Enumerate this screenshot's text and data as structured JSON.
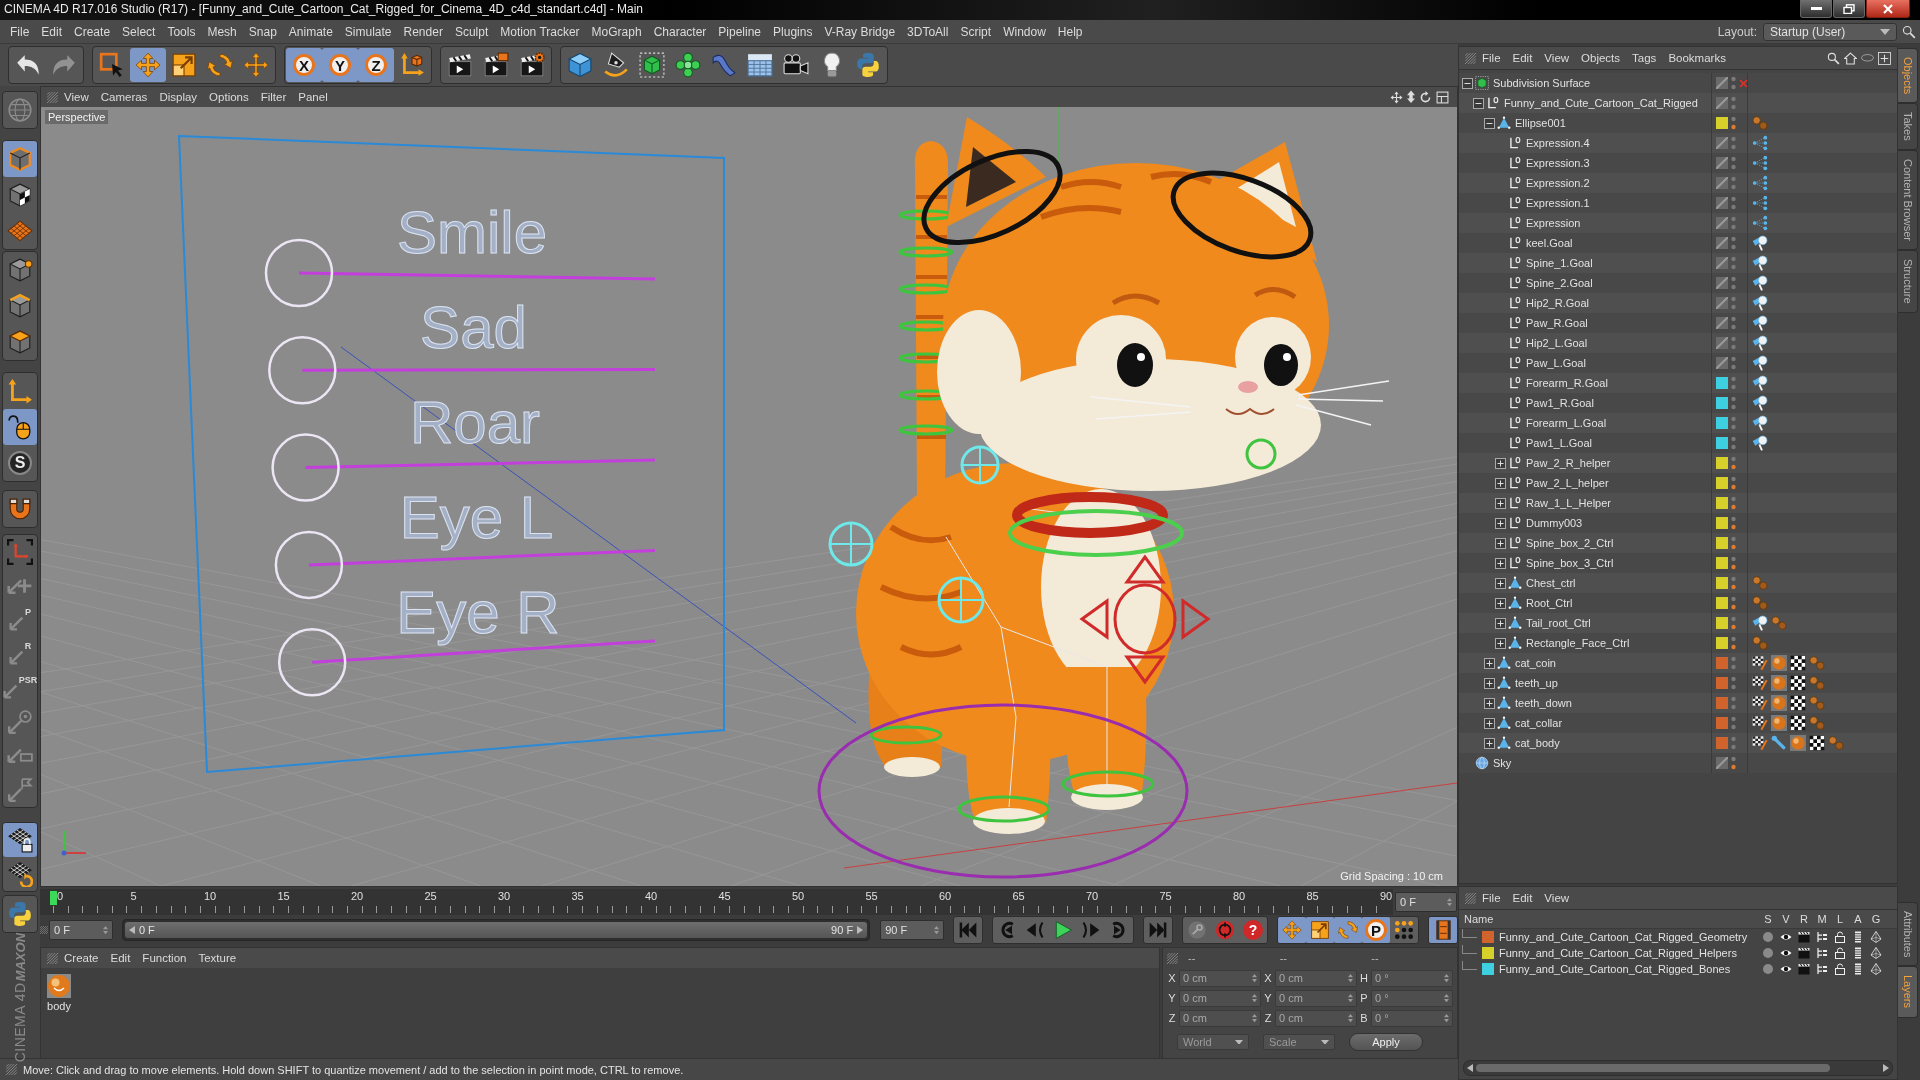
{
  "window": {
    "title": "CINEMA 4D R17.016 Studio (R17) - [Funny_and_Cute_Cartoon_Cat_Rigged_for_Cinema_4D_c4d_standart.c4d] - Main"
  },
  "menu_bar": {
    "items": [
      "File",
      "Edit",
      "Create",
      "Select",
      "Tools",
      "Mesh",
      "Snap",
      "Animate",
      "Simulate",
      "Render",
      "Sculpt",
      "Motion Tracker",
      "MoGraph",
      "Character",
      "Pipeline",
      "Plugins",
      "V-Ray Bridge",
      "3DToAll",
      "Script",
      "Window",
      "Help"
    ],
    "layout_label": "Layout:",
    "layout_value": "Startup (User)"
  },
  "toolbar": {
    "groups": [
      [
        {
          "kind": "undo",
          "disabled": false
        },
        {
          "kind": "redo",
          "disabled": true
        }
      ],
      [
        {
          "kind": "select",
          "selected": false
        },
        {
          "kind": "move",
          "selected": true
        },
        {
          "kind": "scale",
          "selected": false
        },
        {
          "kind": "rotate",
          "selected": false
        },
        {
          "kind": "last",
          "selected": false
        }
      ],
      [
        {
          "kind": "axis_lock",
          "label": "X",
          "selected": true
        },
        {
          "kind": "axis_lock",
          "label": "Y",
          "selected": true
        },
        {
          "kind": "axis_lock",
          "label": "Z",
          "selected": true
        },
        {
          "kind": "coords",
          "selected": false
        }
      ],
      [
        {
          "kind": "render_view"
        },
        {
          "kind": "render_picture"
        },
        {
          "kind": "render_settings"
        }
      ],
      [
        {
          "kind": "cube"
        },
        {
          "kind": "pen"
        },
        {
          "kind": "subdivision"
        },
        {
          "kind": "cloner"
        },
        {
          "kind": "deformer"
        },
        {
          "kind": "floor"
        },
        {
          "kind": "camera"
        },
        {
          "kind": "light"
        },
        {
          "kind": "python"
        }
      ]
    ]
  },
  "left_palette": {
    "groups": [
      [
        {
          "kind": "globe",
          "disabled": true
        }
      ],
      [
        {
          "kind": "model",
          "selected": true
        },
        {
          "kind": "texture",
          "selected": false
        },
        {
          "kind": "workplane",
          "selected": false
        }
      ],
      [
        {
          "kind": "points",
          "selected": false
        },
        {
          "kind": "edges",
          "selected": false
        },
        {
          "kind": "polygons",
          "selected": false
        }
      ],
      [
        {
          "kind": "axis",
          "selected": false
        },
        {
          "kind": "tweak",
          "selected": true
        },
        {
          "kind": "snap",
          "label": "S",
          "selected": false
        }
      ],
      [
        {
          "kind": "magnet",
          "selected": false
        }
      ],
      [
        {
          "kind": "axis_corners",
          "disabled": false
        },
        {
          "kind": "quantize",
          "disabled": true
        },
        {
          "kind": "lock",
          "label": "P",
          "disabled": true
        },
        {
          "kind": "lock",
          "label": "R",
          "disabled": true
        },
        {
          "kind": "lock",
          "label": "PSR",
          "disabled": true
        },
        {
          "kind": "circle_lock",
          "disabled": true
        },
        {
          "kind": "rect_lock",
          "disabled": true
        },
        {
          "kind": "flag_lock",
          "disabled": true
        }
      ],
      [
        {
          "kind": "grid_lock",
          "selected": true
        },
        {
          "kind": "grid_cycle",
          "selected": false
        }
      ],
      [
        {
          "kind": "python"
        }
      ]
    ]
  },
  "viewport": {
    "menu": [
      "View",
      "Cameras",
      "Display",
      "Options",
      "Filter",
      "Panel"
    ],
    "camera": "Perspective",
    "grid_spacing": "Grid Spacing : 10 cm",
    "face_sliders": [
      {
        "label": "Smile",
        "level": 0
      },
      {
        "label": "Sad",
        "level": 0
      },
      {
        "label": "Roar",
        "level": 0
      },
      {
        "label": "Eye L",
        "level": 0
      },
      {
        "label": "Eye R",
        "level": 0
      }
    ]
  },
  "object_manager": {
    "menu": [
      "File",
      "Edit",
      "View",
      "Objects",
      "Tags",
      "Bookmarks"
    ],
    "objects": [
      {
        "name": "Subdivision Surface",
        "kind": "subdivision",
        "expanded": true,
        "generator_enabled": false,
        "render_dot_lit": false,
        "children": [
          {
            "name": "Funny_and_Cute_Cartoon_Cat_Rigged",
            "kind": "null",
            "expanded": true,
            "render_dot_lit": false,
            "children": [
              {
                "name": "Ellipse001",
                "kind": "polygon",
                "expanded": true,
                "color": "#d8d02a",
                "render_dot_lit": true,
                "tags": [
                  {
                    "kind": "dots"
                  }
                ],
                "children": [
                  {
                    "name": "Expression.4",
                    "kind": "null",
                    "render_dot_lit": false,
                    "tags": [
                      {
                        "kind": "xpresso"
                      }
                    ]
                  },
                  {
                    "name": "Expression.3",
                    "kind": "null",
                    "render_dot_lit": false,
                    "tags": [
                      {
                        "kind": "xpresso"
                      }
                    ]
                  },
                  {
                    "name": "Expression.2",
                    "kind": "null",
                    "render_dot_lit": false,
                    "tags": [
                      {
                        "kind": "xpresso"
                      }
                    ]
                  },
                  {
                    "name": "Expression.1",
                    "kind": "null",
                    "render_dot_lit": false,
                    "tags": [
                      {
                        "kind": "xpresso"
                      }
                    ]
                  },
                  {
                    "name": "Expression",
                    "kind": "null",
                    "render_dot_lit": false,
                    "tags": [
                      {
                        "kind": "xpresso"
                      }
                    ]
                  },
                  {
                    "name": "keel.Goal",
                    "kind": "null",
                    "render_dot_lit": false,
                    "tags": [
                      {
                        "kind": "ik"
                      }
                    ]
                  },
                  {
                    "name": "Spine_1.Goal",
                    "kind": "null",
                    "render_dot_lit": false,
                    "tags": [
                      {
                        "kind": "ik"
                      }
                    ]
                  },
                  {
                    "name": "Spine_2.Goal",
                    "kind": "null",
                    "render_dot_lit": false,
                    "tags": [
                      {
                        "kind": "ik"
                      }
                    ]
                  },
                  {
                    "name": "Hip2_R.Goal",
                    "kind": "null",
                    "render_dot_lit": false,
                    "tags": [
                      {
                        "kind": "ik"
                      }
                    ]
                  },
                  {
                    "name": "Paw_R.Goal",
                    "kind": "null",
                    "render_dot_lit": false,
                    "tags": [
                      {
                        "kind": "ik"
                      }
                    ]
                  },
                  {
                    "name": "Hip2_L.Goal",
                    "kind": "null",
                    "render_dot_lit": false,
                    "tags": [
                      {
                        "kind": "ik"
                      }
                    ]
                  },
                  {
                    "name": "Paw_L.Goal",
                    "kind": "null",
                    "render_dot_lit": false,
                    "tags": [
                      {
                        "kind": "ik"
                      }
                    ]
                  },
                  {
                    "name": "Forearm_R.Goal",
                    "kind": "null",
                    "color": "#3ed0e0",
                    "render_dot_lit": false,
                    "tags": [
                      {
                        "kind": "ik"
                      }
                    ]
                  },
                  {
                    "name": "Paw1_R.Goal",
                    "kind": "null",
                    "color": "#3ed0e0",
                    "render_dot_lit": false,
                    "tags": [
                      {
                        "kind": "ik"
                      }
                    ]
                  },
                  {
                    "name": "Forearm_L.Goal",
                    "kind": "null",
                    "color": "#3ed0e0",
                    "render_dot_lit": false,
                    "tags": [
                      {
                        "kind": "ik"
                      }
                    ]
                  },
                  {
                    "name": "Paw1_L.Goal",
                    "kind": "null",
                    "color": "#3ed0e0",
                    "render_dot_lit": false,
                    "tags": [
                      {
                        "kind": "ik"
                      }
                    ]
                  },
                  {
                    "name": "Paw_2_R_helper",
                    "kind": "null",
                    "expanded": false,
                    "color": "#d8d02a",
                    "render_dot_lit": true
                  },
                  {
                    "name": "Paw_2_L_helper",
                    "kind": "null",
                    "expanded": false,
                    "color": "#d8d02a",
                    "render_dot_lit": true
                  },
                  {
                    "name": "Raw_1_L_Helper",
                    "kind": "null",
                    "expanded": false,
                    "color": "#d8d02a",
                    "render_dot_lit": true
                  },
                  {
                    "name": "Dummy003",
                    "kind": "null",
                    "expanded": false,
                    "color": "#d8d02a",
                    "render_dot_lit": true
                  },
                  {
                    "name": "Spine_box_2_Ctrl",
                    "kind": "null",
                    "expanded": false,
                    "color": "#d8d02a",
                    "render_dot_lit": true
                  },
                  {
                    "name": "Spine_box_3_Ctrl",
                    "kind": "null",
                    "expanded": false,
                    "color": "#d8d02a",
                    "render_dot_lit": true
                  },
                  {
                    "name": "Chest_ctrl",
                    "kind": "polygon",
                    "expanded": false,
                    "color": "#d8d02a",
                    "render_dot_lit": true,
                    "tags": [
                      {
                        "kind": "dots"
                      }
                    ]
                  },
                  {
                    "name": "Root_Ctrl",
                    "kind": "polygon",
                    "expanded": false,
                    "color": "#d8d02a",
                    "render_dot_lit": true,
                    "tags": [
                      {
                        "kind": "dots"
                      }
                    ]
                  },
                  {
                    "name": "Tail_root_Ctrl",
                    "kind": "polygon",
                    "expanded": false,
                    "color": "#d8d02a",
                    "render_dot_lit": true,
                    "tags": [
                      {
                        "kind": "ik"
                      },
                      {
                        "kind": "dots"
                      }
                    ]
                  },
                  {
                    "name": "Rectangle_Face_Ctrl",
                    "kind": "polygon",
                    "expanded": false,
                    "color": "#d8d02a",
                    "render_dot_lit": true,
                    "tags": [
                      {
                        "kind": "dots"
                      }
                    ]
                  }
                ]
              },
              {
                "name": "cat_coin",
                "kind": "polygon",
                "expanded": false,
                "color": "#d0642c",
                "render_dot_lit": false,
                "tags": [
                  {
                    "kind": "uvw"
                  },
                  {
                    "kind": "material"
                  },
                  {
                    "kind": "checker"
                  },
                  {
                    "kind": "dots"
                  }
                ]
              },
              {
                "name": "teeth_up",
                "kind": "polygon",
                "expanded": false,
                "color": "#d0642c",
                "render_dot_lit": false,
                "tags": [
                  {
                    "kind": "uvw"
                  },
                  {
                    "kind": "material"
                  },
                  {
                    "kind": "checker"
                  },
                  {
                    "kind": "dots"
                  }
                ]
              },
              {
                "name": "teeth_down",
                "kind": "polygon",
                "expanded": false,
                "color": "#d0642c",
                "render_dot_lit": false,
                "tags": [
                  {
                    "kind": "uvw"
                  },
                  {
                    "kind": "material"
                  },
                  {
                    "kind": "checker"
                  },
                  {
                    "kind": "dots"
                  }
                ]
              },
              {
                "name": "cat_collar",
                "kind": "polygon",
                "expanded": false,
                "color": "#d0642c",
                "render_dot_lit": false,
                "tags": [
                  {
                    "kind": "uvw"
                  },
                  {
                    "kind": "material"
                  },
                  {
                    "kind": "checker"
                  },
                  {
                    "kind": "dots"
                  }
                ]
              },
              {
                "name": "cat_body",
                "kind": "polygon",
                "expanded": false,
                "color": "#d0642c",
                "render_dot_lit": false,
                "tags": [
                  {
                    "kind": "uvw"
                  },
                  {
                    "kind": "joint"
                  },
                  {
                    "kind": "material"
                  },
                  {
                    "kind": "checker"
                  },
                  {
                    "kind": "dots"
                  }
                ]
              }
            ]
          }
        ]
      },
      {
        "name": "Sky",
        "kind": "sky",
        "render_dot_lit": true
      }
    ]
  },
  "side_tabs": {
    "upper": [
      {
        "label": "Objects",
        "selected": true
      },
      {
        "label": "Takes",
        "selected": false
      },
      {
        "label": "Content Browser",
        "selected": false
      },
      {
        "label": "Structure",
        "selected": false
      }
    ],
    "lower": [
      {
        "label": "Attributes",
        "selected": false
      },
      {
        "label": "Layers",
        "selected": true
      }
    ]
  },
  "timeline": {
    "frames": [
      "0",
      "5",
      "10",
      "15",
      "20",
      "25",
      "30",
      "35",
      "40",
      "45",
      "50",
      "55",
      "60",
      "65",
      "70",
      "75",
      "80",
      "85",
      "90"
    ],
    "level": 0,
    "current_frame": "0 F"
  },
  "transport": {
    "start_field": "0 F",
    "range_start": "0 F",
    "range_end": "90 F",
    "level": 1,
    "end_field": "90 F",
    "groups": [
      [
        {
          "kind": "to_start"
        }
      ],
      [
        {
          "kind": "prev_key"
        },
        {
          "kind": "prev_frame"
        },
        {
          "kind": "play"
        },
        {
          "kind": "next_frame"
        },
        {
          "kind": "next_key"
        }
      ],
      [
        {
          "kind": "to_end"
        }
      ],
      [
        {
          "kind": "key"
        },
        {
          "kind": "record"
        },
        {
          "kind": "help",
          "label": "?"
        }
      ],
      [
        {
          "kind": "move",
          "selected": true
        },
        {
          "kind": "scale",
          "selected": true
        },
        {
          "kind": "rotate",
          "selected": true
        },
        {
          "kind": "param",
          "label": "P",
          "selected": true
        },
        {
          "kind": "pla",
          "selected": false
        }
      ],
      [
        {
          "kind": "timeline",
          "selected": true
        }
      ]
    ]
  },
  "layer_manager": {
    "menu": [
      "File",
      "Edit",
      "View"
    ],
    "columns": [
      "Name",
      "S",
      "V",
      "R",
      "M",
      "L",
      "A",
      "G"
    ],
    "layers": [
      {
        "name": "Funny_and_Cute_Cartoon_Cat_Rigged_Geometry",
        "color": "#d0642c"
      },
      {
        "name": "Funny_and_Cute_Cartoon_Cat_Rigged_Helpers",
        "color": "#d8d02a"
      },
      {
        "name": "Funny_and_Cute_Cartoon_Cat_Rigged_Bones",
        "color": "#3ed0e0"
      }
    ]
  },
  "material_manager": {
    "menu": [
      "Create",
      "Edit",
      "Function",
      "Texture"
    ],
    "materials": [
      {
        "name": "body"
      }
    ]
  },
  "coordinates": {
    "headers": [
      "--",
      "--",
      "--"
    ],
    "rows": [
      [
        {
          "label": "X",
          "value": "0 cm"
        },
        {
          "label": "X",
          "value": "0 cm"
        },
        {
          "label": "H",
          "value": "0 °"
        }
      ],
      [
        {
          "label": "Y",
          "value": "0 cm"
        },
        {
          "label": "Y",
          "value": "0 cm"
        },
        {
          "label": "P",
          "value": "0 °"
        }
      ],
      [
        {
          "label": "Z",
          "value": "0 cm"
        },
        {
          "label": "Z",
          "value": "0 cm"
        },
        {
          "label": "B",
          "value": "0 °"
        }
      ]
    ],
    "dropdowns": [
      "World",
      "Scale"
    ],
    "apply": "Apply"
  },
  "brand": {
    "maker": "MAXON",
    "product": "CINEMA 4D"
  },
  "status_bar": {
    "text": "Move: Click and drag to move elements. Hold down SHIFT to quantize movement / add to the selection in point mode, CTRL to remove."
  }
}
